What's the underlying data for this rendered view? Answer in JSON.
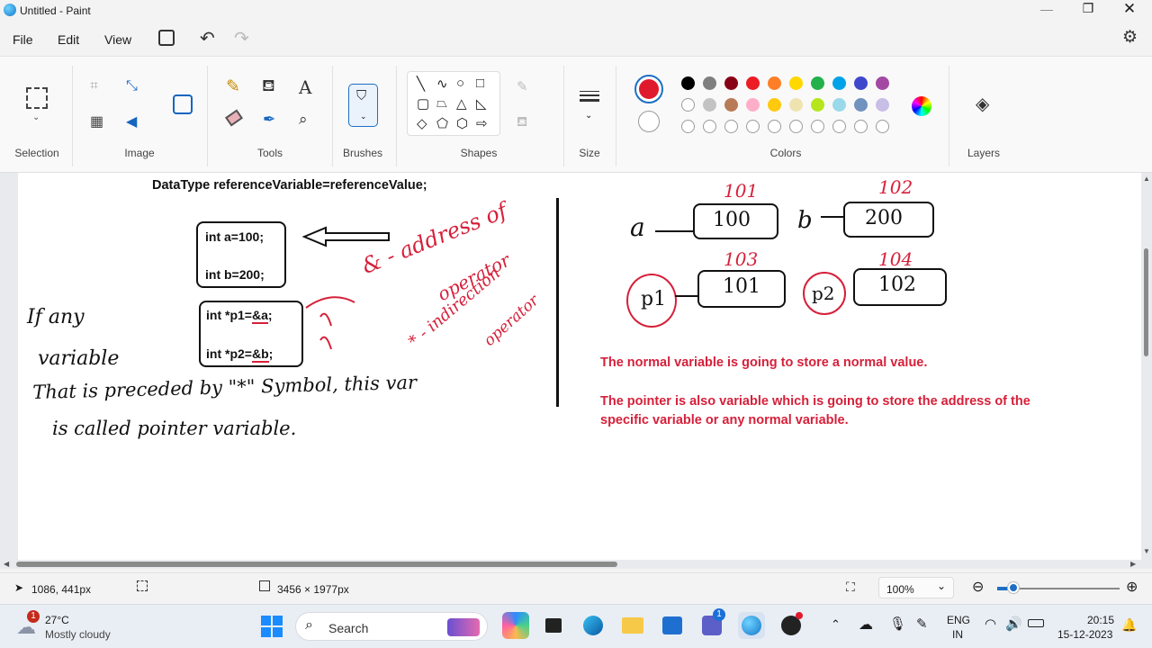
{
  "window": {
    "title": "Untitled - Paint"
  },
  "menu": {
    "file": "File",
    "edit": "Edit",
    "view": "View"
  },
  "ribbon": {
    "groups": {
      "selection": "Selection",
      "image": "Image",
      "tools": "Tools",
      "brushes": "Brushes",
      "shapes": "Shapes",
      "size": "Size",
      "colors": "Colors",
      "layers": "Layers"
    },
    "colors": {
      "primary": "#e01a2e",
      "secondary": "#ffffff",
      "palette_row1": [
        "#000000",
        "#7f7f7f",
        "#880015",
        "#ed1c24",
        "#ff7f27",
        "#ffd800",
        "#22b14c",
        "#00a2e8",
        "#3f48cc",
        "#a349a4"
      ],
      "palette_row2": [
        "#ffffff",
        "#c3c3c3",
        "#b97a57",
        "#ffaec9",
        "#ffc90e",
        "#efe4b0",
        "#b5e61d",
        "#99d9ea",
        "#7092be",
        "#c8bfe7"
      ]
    }
  },
  "canvas": {
    "heading": "DataType referenceVariable=referenceValue;",
    "box1": {
      "line1": "int a=100;",
      "line2": "int b=200;"
    },
    "box2": {
      "line1_prefix": "int *p1=",
      "line1_ref": "&a",
      "line1_end": ";",
      "line2_prefix": "int *p2=",
      "line2_ref": "&b",
      "line2_end": ";"
    },
    "handwriting": {
      "line1": "If any",
      "line2": "variable",
      "line3": "That is preceded by \"*\" Symbol, this var",
      "line4": "is called pointer variable.",
      "amp_note": "& - address of",
      "amp_note2": "operator",
      "star_note": "* - indirection",
      "star_note2": "operator"
    },
    "diagram": {
      "label_a": "a",
      "label_b": "b",
      "box_a_value": "100",
      "box_b_value": "200",
      "addr_a": "101",
      "addr_b": "102",
      "addr_p1": "103",
      "addr_p2": "104",
      "label_p1": "p1",
      "label_p2": "p2",
      "box_p1_value": "101",
      "box_p2_value": "102"
    },
    "note1": "The normal variable is going to store a normal value.",
    "note2_line1": "The pointer is also variable which is going to store the address of the",
    "note2_line2": "specific variable or any normal variable."
  },
  "status": {
    "cursor": "1086, 441px",
    "canvas_size": "3456 × 1977px",
    "zoom": "100%"
  },
  "taskbar": {
    "weather_temp": "27°C",
    "weather_desc": "Mostly cloudy",
    "weather_badge": "1",
    "search": "Search",
    "lang1": "ENG",
    "lang2": "IN",
    "time": "20:15",
    "date": "15-12-2023",
    "teams_badge": "1"
  }
}
